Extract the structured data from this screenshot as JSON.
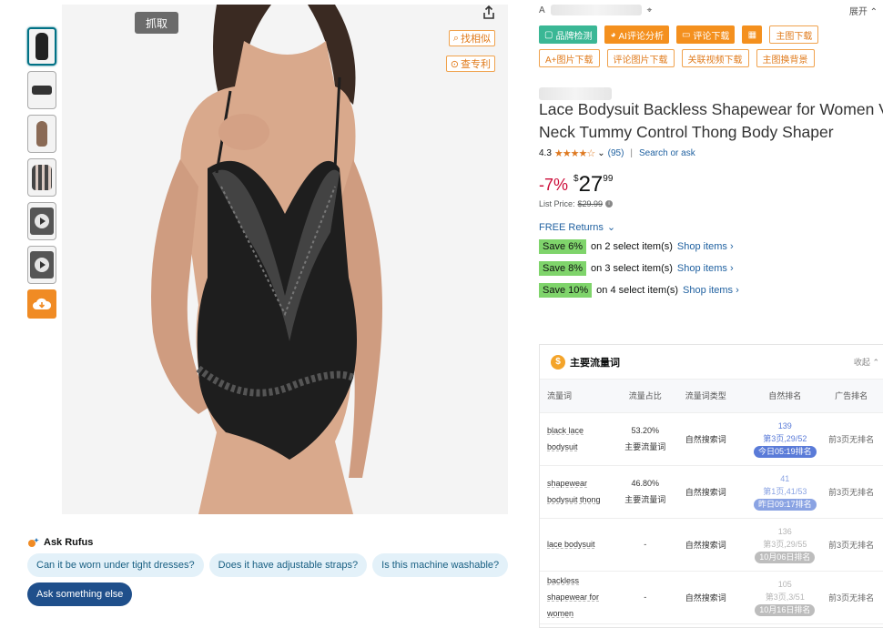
{
  "thumbnails": [
    {
      "type": "image",
      "active": true
    },
    {
      "type": "image",
      "active": false
    },
    {
      "type": "image",
      "active": false
    },
    {
      "type": "image",
      "active": false
    },
    {
      "type": "video",
      "active": false
    },
    {
      "type": "video",
      "active": false
    }
  ],
  "image_tools": {
    "grab_label": "抓取",
    "find_similar_label": "找相似",
    "check_patent_label": "查专利"
  },
  "rufus": {
    "title": "Ask Rufus",
    "chips": [
      "Can it be worn under tight dresses?",
      "Does it have adjustable straps?",
      "Is this machine washable?"
    ],
    "primary_chip": "Ask something else"
  },
  "topbar": {
    "prefix": "A",
    "expand_label": "展开"
  },
  "tools": {
    "brand_check": "品牌检测",
    "ai_review": "AI评论分析",
    "review_download": "评论下载",
    "calc_icon": "calculator-icon",
    "main_image_download": "主图下载",
    "aplus_download": "A+图片下载",
    "review_image_download": "评论图片下载",
    "related_video_download": "关联视频下载",
    "main_image_bg": "主图换背景"
  },
  "product": {
    "title": "Lace Bodysuit Backless Shapewear for Women V-Neck Tummy Control Thong Body Shaper",
    "rating": "4.3",
    "stars": "★★★★☆",
    "review_count": "(95)",
    "search_or_ask": "Search or ask",
    "discount": "-7%",
    "price_symbol": "$",
    "price_whole": "27",
    "price_fraction": "99",
    "list_price_label": "List Price:",
    "list_price": "$29.99",
    "returns": "FREE Returns",
    "savings": [
      {
        "badge": "Save 6%",
        "text": "on 2 select item(s)",
        "link": "Shop items ›"
      },
      {
        "badge": "Save 8%",
        "text": "on 3 select item(s)",
        "link": "Shop items ›"
      },
      {
        "badge": "Save 10%",
        "text": "on 4 select item(s)",
        "link": "Shop items ›"
      }
    ]
  },
  "keywords": {
    "title": "主要流量词",
    "collapse_label": "收起",
    "columns": [
      "流量词",
      "流量占比",
      "流量词类型",
      "自然排名",
      "广告排名"
    ],
    "rows": [
      {
        "word_lines": [
          "black lace",
          "bodysuit"
        ],
        "share": "53.20%",
        "share_type": "主要流量词",
        "kw_type": "自然搜索词",
        "rank": "139",
        "rank_page": "第3页,29/52",
        "rank_time": "今日05:19排名",
        "ad_rank": "前3页无排名"
      },
      {
        "word_lines": [
          "shapewear",
          "bodysuit thong"
        ],
        "share": "46.80%",
        "share_type": "主要流量词",
        "kw_type": "自然搜索词",
        "rank": "41",
        "rank_page": "第1页,41/53",
        "rank_time": "昨日09:17排名",
        "ad_rank": "前3页无排名"
      },
      {
        "word_lines": [
          "lace bodysuit"
        ],
        "share": "-",
        "share_type": "",
        "kw_type": "自然搜索词",
        "rank": "136",
        "rank_page": "第3页,29/55",
        "rank_time": "10月06日排名",
        "ad_rank": "前3页无排名"
      },
      {
        "word_lines": [
          "backless",
          "shapewear for",
          "women"
        ],
        "share": "-",
        "share_type": "",
        "kw_type": "自然搜索词",
        "rank": "105",
        "rank_page": "第3页,3/51",
        "rank_time": "10月16日排名",
        "ad_rank": "前3页无排名"
      }
    ]
  }
}
